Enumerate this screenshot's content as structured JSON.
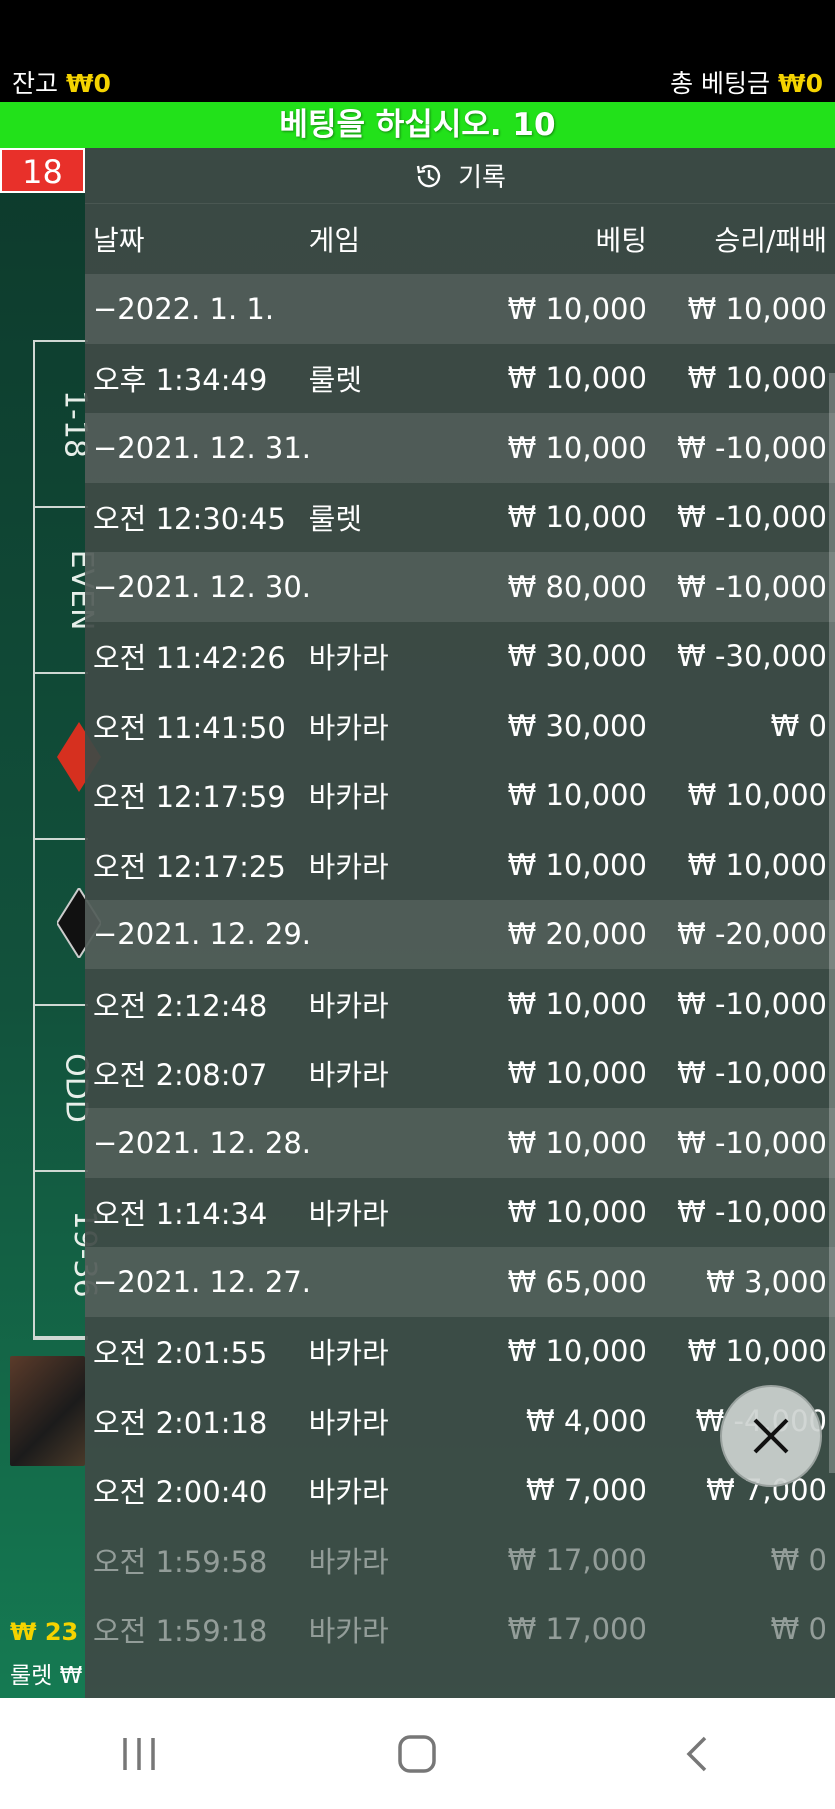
{
  "top": {
    "balance_label": "잔고",
    "balance_value": "₩0",
    "total_bet_label": "총 베팅금",
    "total_bet_value": "₩0"
  },
  "banner": {
    "text": "베팅을 하십시오. 10"
  },
  "background": {
    "red_number": "18",
    "bet_cells": [
      "1-18",
      "EVEN",
      "",
      "",
      "ODD",
      "19-36"
    ],
    "bottom_amount": "₩ 23",
    "bottom_label": "룰렛 ₩"
  },
  "history": {
    "title": "기록",
    "headers": {
      "date": "날짜",
      "game": "게임",
      "bet": "베팅",
      "result": "승리/패배"
    },
    "rows": [
      {
        "type": "group",
        "date": "−2022. 1. 1.",
        "bet": "₩ 10,000",
        "result": "₩ 10,000"
      },
      {
        "type": "item",
        "time": "오후 1:34:49",
        "game": "룰렛",
        "bet": "₩ 10,000",
        "result": "₩ 10,000"
      },
      {
        "type": "group",
        "date": "−2021. 12. 31.",
        "bet": "₩ 10,000",
        "result": "₩ -10,000"
      },
      {
        "type": "item",
        "time": "오전 12:30:45",
        "game": "룰렛",
        "bet": "₩ 10,000",
        "result": "₩ -10,000"
      },
      {
        "type": "group",
        "date": "−2021. 12. 30.",
        "bet": "₩ 80,000",
        "result": "₩ -10,000"
      },
      {
        "type": "item",
        "time": "오전 11:42:26",
        "game": "바카라",
        "bet": "₩ 30,000",
        "result": "₩ -30,000"
      },
      {
        "type": "item",
        "time": "오전 11:41:50",
        "game": "바카라",
        "bet": "₩ 30,000",
        "result": "₩ 0"
      },
      {
        "type": "item",
        "time": "오전 12:17:59",
        "game": "바카라",
        "bet": "₩ 10,000",
        "result": "₩ 10,000"
      },
      {
        "type": "item",
        "time": "오전 12:17:25",
        "game": "바카라",
        "bet": "₩ 10,000",
        "result": "₩ 10,000"
      },
      {
        "type": "group",
        "date": "−2021. 12. 29.",
        "bet": "₩ 20,000",
        "result": "₩ -20,000"
      },
      {
        "type": "item",
        "time": "오전 2:12:48",
        "game": "바카라",
        "bet": "₩ 10,000",
        "result": "₩ -10,000"
      },
      {
        "type": "item",
        "time": "오전 2:08:07",
        "game": "바카라",
        "bet": "₩ 10,000",
        "result": "₩ -10,000"
      },
      {
        "type": "group",
        "date": "−2021. 12. 28.",
        "bet": "₩ 10,000",
        "result": "₩ -10,000"
      },
      {
        "type": "item",
        "time": "오전 1:14:34",
        "game": "바카라",
        "bet": "₩ 10,000",
        "result": "₩ -10,000"
      },
      {
        "type": "group",
        "date": "−2021. 12. 27.",
        "bet": "₩ 65,000",
        "result": "₩ 3,000"
      },
      {
        "type": "item",
        "time": "오전 2:01:55",
        "game": "바카라",
        "bet": "₩ 10,000",
        "result": "₩ 10,000"
      },
      {
        "type": "item",
        "time": "오전 2:01:18",
        "game": "바카라",
        "bet": "₩ 4,000",
        "result": "₩ -4,000"
      },
      {
        "type": "item",
        "time": "오전 2:00:40",
        "game": "바카라",
        "bet": "₩ 7,000",
        "result": "₩ 7,000"
      },
      {
        "type": "item",
        "time": "오전 1:59:58",
        "game": "바카라",
        "bet": "₩ 17,000",
        "result": "₩ 0",
        "fade": true
      },
      {
        "type": "item",
        "time": "오전 1:59:18",
        "game": "바카라",
        "bet": "₩ 17,000",
        "result": "₩ 0",
        "fade": true
      }
    ]
  },
  "colors": {
    "banner": "#22e11a",
    "accent_yellow": "#f5d300",
    "red": "#e8302a"
  },
  "icons": {
    "title": "history-clock-icon",
    "close": "close-icon",
    "nav": [
      "recent-apps-icon",
      "home-icon",
      "back-icon"
    ]
  }
}
